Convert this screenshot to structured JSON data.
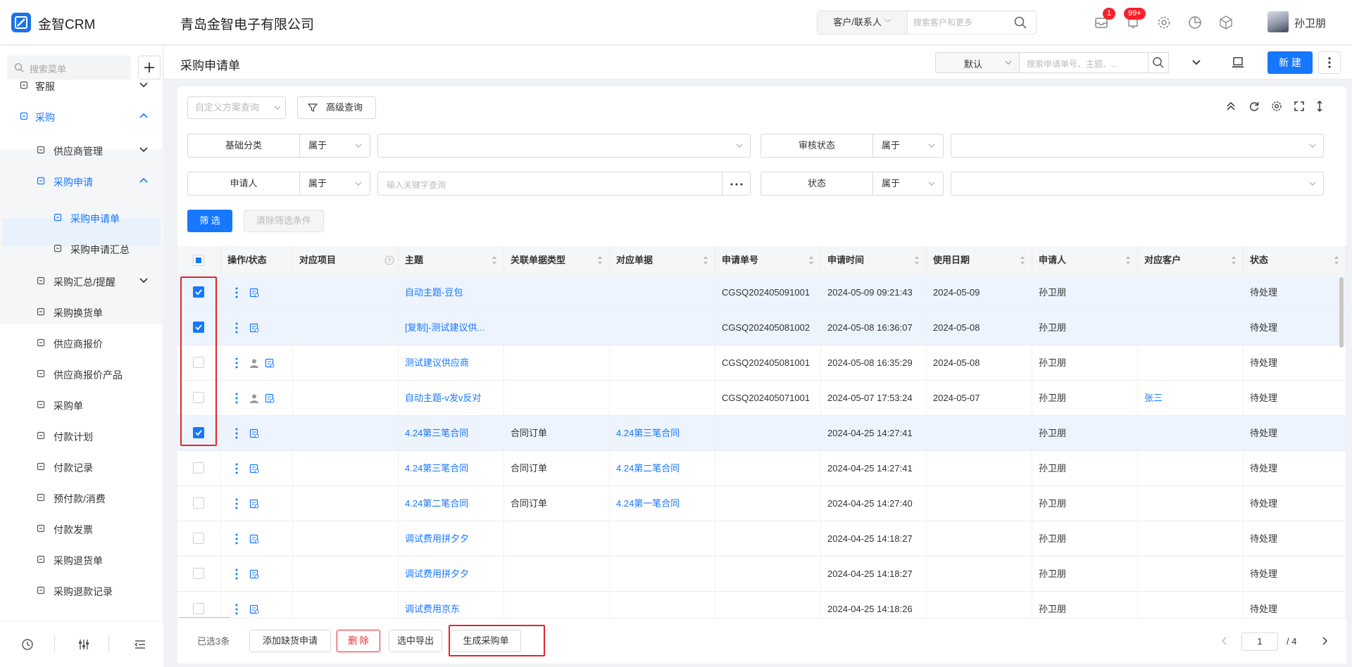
{
  "app": {
    "name": "金智CRM",
    "company": "青岛金智电子有限公司",
    "search_scope": "客户/联系人",
    "search_placeholder": "搜索客户和更多",
    "inbox_badge": "1",
    "bell_badge": "99+",
    "user_name": "孙卫朋"
  },
  "sidebar": {
    "search_placeholder": "搜索菜单",
    "items": [
      {
        "label": "客服",
        "level": 1,
        "expanded": false,
        "icon": "headset-icon"
      },
      {
        "label": "采购",
        "level": 1,
        "expanded": true,
        "active": true,
        "icon": "bag-icon"
      },
      {
        "label": "供应商管理",
        "level": 2,
        "expanded": false,
        "icon": "copy-icon"
      },
      {
        "label": "采购申请",
        "level": 2,
        "expanded": true,
        "active": true,
        "icon": "copy-icon"
      },
      {
        "label": "采购申请单",
        "level": 3,
        "selected": true,
        "icon": "plus-box-icon"
      },
      {
        "label": "采购申请汇总",
        "level": 3,
        "icon": "calculator-icon"
      },
      {
        "label": "采购汇总/提醒",
        "level": 2,
        "expanded": false,
        "icon": "copy-icon"
      },
      {
        "label": "采购换货单",
        "level": 2,
        "icon": "list-doc-icon"
      },
      {
        "label": "供应商报价",
        "level": 2,
        "icon": "quote-icon"
      },
      {
        "label": "供应商报价产品",
        "level": 2,
        "icon": "quote-icon"
      },
      {
        "label": "采购单",
        "level": 2,
        "icon": "bag-icon"
      },
      {
        "label": "付款计划",
        "level": 2,
        "icon": "doc-edit-icon"
      },
      {
        "label": "付款记录",
        "level": 2,
        "icon": "doc-edit-icon"
      },
      {
        "label": "预付款/消费",
        "level": 2,
        "icon": "card-icon"
      },
      {
        "label": "付款发票",
        "level": 2,
        "icon": "invoice-icon"
      },
      {
        "label": "采购退货单",
        "level": 2,
        "icon": "return-doc-icon"
      },
      {
        "label": "采购退款记录",
        "level": 2,
        "icon": "refund-icon"
      }
    ]
  },
  "header": {
    "title": "采购申请单",
    "view_select": "默认",
    "search_placeholder": "搜索申请单号、主题、...",
    "new_button": "新 建"
  },
  "filters": {
    "scheme_placeholder": "自定义方案查询",
    "advanced_button": "高级查询",
    "rows": [
      {
        "label": "基础分类",
        "op": "属于",
        "value": "",
        "type": "select"
      },
      {
        "label": "审核状态",
        "op": "属于",
        "value": "",
        "type": "select"
      },
      {
        "label": "申请人",
        "op": "属于",
        "value": "",
        "placeholder": "输入关键字查询",
        "type": "input"
      },
      {
        "label": "状态",
        "op": "属于",
        "value": "",
        "type": "select"
      }
    ],
    "filter_button": "筛 选",
    "clear_button": "清除筛选条件"
  },
  "table": {
    "columns": [
      "操作/状态",
      "对应项目",
      "主题",
      "关联单据类型",
      "对应单据",
      "申请单号",
      "申请时间",
      "使用日期",
      "申请人",
      "对应客户",
      "状态"
    ],
    "rows": [
      {
        "checked": true,
        "person": false,
        "project": "",
        "subject": "自动主题-豆包",
        "ref_type": "",
        "ref_doc": "",
        "no": "CGSQ202405091001",
        "time": "2024-05-09 09:21:43",
        "use_date": "2024-05-09",
        "applicant": "孙卫朋",
        "customer": "",
        "status": "待处理"
      },
      {
        "checked": true,
        "person": false,
        "project": "",
        "subject": "[复制]-测试建议供...",
        "ref_type": "",
        "ref_doc": "",
        "no": "CGSQ202405081002",
        "time": "2024-05-08 16:36:07",
        "use_date": "2024-05-08",
        "applicant": "孙卫朋",
        "customer": "",
        "status": "待处理"
      },
      {
        "checked": false,
        "person": true,
        "project": "",
        "subject": "测试建议供应商",
        "ref_type": "",
        "ref_doc": "",
        "no": "CGSQ202405081001",
        "time": "2024-05-08 16:35:29",
        "use_date": "2024-05-08",
        "applicant": "孙卫朋",
        "customer": "",
        "status": "待处理"
      },
      {
        "checked": false,
        "person": true,
        "project": "",
        "subject": "自动主题-v发v反对",
        "ref_type": "",
        "ref_doc": "",
        "no": "CGSQ202405071001",
        "time": "2024-05-07 17:53:24",
        "use_date": "2024-05-07",
        "applicant": "孙卫朋",
        "customer": "张三",
        "status": "待处理"
      },
      {
        "checked": true,
        "person": false,
        "project": "",
        "subject": "4.24第三笔合同",
        "ref_type": "合同订单",
        "ref_doc": "4.24第三笔合同",
        "no": "",
        "time": "2024-04-25 14:27:41",
        "use_date": "",
        "applicant": "孙卫朋",
        "customer": "",
        "status": "待处理"
      },
      {
        "checked": false,
        "person": false,
        "project": "",
        "subject": "4.24第三笔合同",
        "ref_type": "合同订单",
        "ref_doc": "4.24第二笔合同",
        "no": "",
        "time": "2024-04-25 14:27:41",
        "use_date": "",
        "applicant": "孙卫朋",
        "customer": "",
        "status": "待处理"
      },
      {
        "checked": false,
        "person": false,
        "project": "",
        "subject": "4.24第二笔合同",
        "ref_type": "合同订单",
        "ref_doc": "4.24第一笔合同",
        "no": "",
        "time": "2024-04-25 14:27:40",
        "use_date": "",
        "applicant": "孙卫朋",
        "customer": "",
        "status": "待处理"
      },
      {
        "checked": false,
        "person": false,
        "project": "",
        "subject": "调试费用拼夕夕",
        "ref_type": "",
        "ref_doc": "",
        "no": "",
        "time": "2024-04-25 14:18:27",
        "use_date": "",
        "applicant": "孙卫朋",
        "customer": "",
        "status": "待处理"
      },
      {
        "checked": false,
        "person": false,
        "project": "",
        "subject": "调试费用拼夕夕",
        "ref_type": "",
        "ref_doc": "",
        "no": "",
        "time": "2024-04-25 14:18:27",
        "use_date": "",
        "applicant": "孙卫朋",
        "customer": "",
        "status": "待处理"
      },
      {
        "checked": false,
        "person": false,
        "project": "",
        "subject": "调试费用京东",
        "ref_type": "",
        "ref_doc": "",
        "no": "",
        "time": "2024-04-25 14:18:26",
        "use_date": "",
        "applicant": "孙卫朋",
        "customer": "",
        "status": "待处理"
      }
    ]
  },
  "footer": {
    "selected_text": "已选3条",
    "buttons": [
      "添加缺货申请",
      "删 除",
      "选中导出",
      "生成采购单"
    ],
    "page_current": "1",
    "page_total": "/ 4"
  },
  "colors": {
    "accent": "#1677ff",
    "danger": "#e0272b",
    "badge": "#f5222d",
    "link": "#1677ff"
  }
}
